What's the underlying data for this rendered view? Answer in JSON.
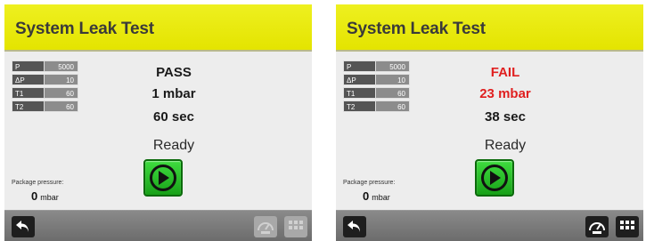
{
  "screens": [
    {
      "title": "System Leak Test",
      "params": [
        {
          "label": "P",
          "value": "5000"
        },
        {
          "label": "ΔP",
          "value": "10"
        },
        {
          "label": "T1",
          "value": "60"
        },
        {
          "label": "T2",
          "value": "60"
        }
      ],
      "status": "PASS",
      "pressure": "1 mbar",
      "time": "60 sec",
      "state": "Ready",
      "package_pressure_label": "Package pressure:",
      "package_pressure_value": "0",
      "package_pressure_unit": "mbar",
      "footer_buttons": {
        "gauge_enabled": false,
        "menu_enabled": false
      }
    },
    {
      "title": "System Leak Test",
      "params": [
        {
          "label": "P",
          "value": "5000"
        },
        {
          "label": "ΔP",
          "value": "10"
        },
        {
          "label": "T1",
          "value": "60"
        },
        {
          "label": "T2",
          "value": "60"
        }
      ],
      "status": "FAIL",
      "pressure": "23 mbar",
      "time": "38 sec",
      "state": "Ready",
      "package_pressure_label": "Package pressure:",
      "package_pressure_value": "0",
      "package_pressure_unit": "mbar",
      "footer_buttons": {
        "gauge_enabled": true,
        "menu_enabled": true
      }
    }
  ],
  "colors": {
    "header": "#e8e800",
    "fail": "#e02020",
    "play": "#22b522"
  },
  "icons": [
    "back-icon",
    "play-icon",
    "gauge-icon",
    "grid-menu-icon"
  ]
}
